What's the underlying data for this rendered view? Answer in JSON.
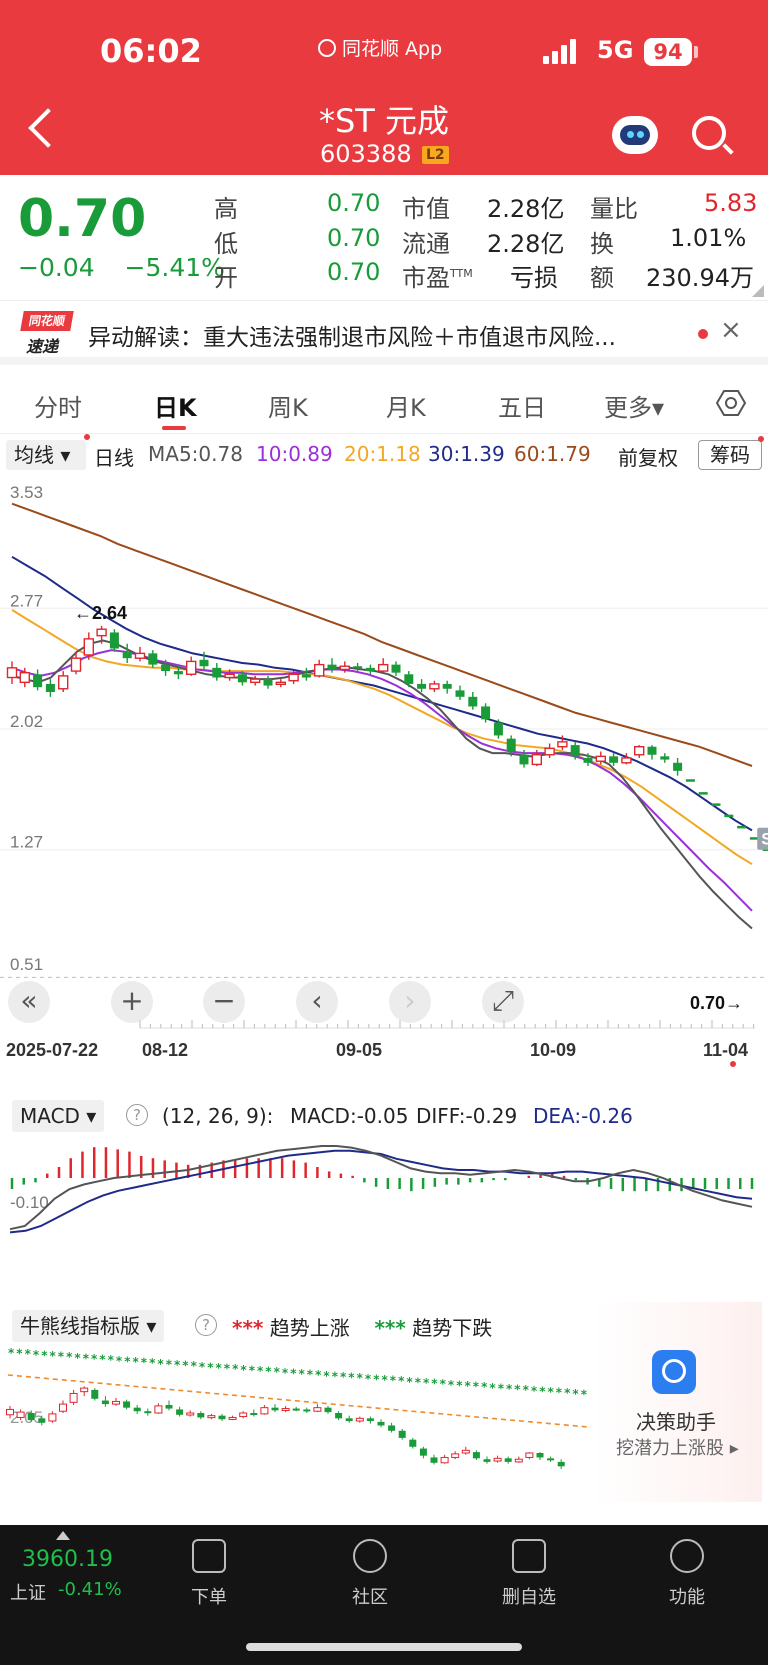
{
  "status_bar": {
    "time": "06:02",
    "app": "同花顺 App",
    "network": "5G",
    "battery": "94"
  },
  "header": {
    "stock_name": "*ST 元成",
    "stock_code": "603388",
    "level_badge": "L2"
  },
  "quote": {
    "price": "0.70",
    "change": "−0.04",
    "change_pct": "−5.41%",
    "high_label": "高",
    "high": "0.70",
    "low_label": "低",
    "low": "0.70",
    "open_label": "开",
    "open": "0.70",
    "mcap_label": "市值",
    "mcap": "2.28亿",
    "float_label": "流通",
    "float": "2.28亿",
    "pe_label": "市盈",
    "pe_sup": "TTM",
    "pe": "亏损",
    "volratio_label": "量比",
    "volratio": "5.83",
    "turnover_label": "换",
    "turnover": "1.01%",
    "amount_label": "额",
    "amount": "230.94万"
  },
  "news": {
    "logo_top": "同花顺",
    "logo_bottom": "速递",
    "text": "异动解读：重大违法强制退市风险＋市值退市风险...",
    "close": "×"
  },
  "tabs": [
    "分时",
    "日K",
    "周K",
    "月K",
    "五日",
    "更多▾"
  ],
  "active_tab": 1,
  "ma_bar": {
    "selector": "均线 ▾",
    "period": "日线",
    "ma5": "MA5:0.78",
    "ma10": "10:0.89",
    "ma20": "20:1.18",
    "ma30": "30:1.39",
    "ma60": "60:1.79",
    "adjust": "前复权",
    "chips": "筹码"
  },
  "colors": {
    "up": "#e0262d",
    "down": "#1a9b3a",
    "ma5": "#555555",
    "ma10": "#9b2fd8",
    "ma20": "#f3a825",
    "ma30": "#1f2a8a",
    "ma60": "#9b4a1a"
  },
  "kline": {
    "y_ticks": [
      "3.53",
      "2.77",
      "2.02",
      "1.27",
      "0.51"
    ],
    "high_marker": "←2.64",
    "last_marker": "0.70→",
    "signal_marker": "S",
    "x_ticks": [
      "2025-07-22",
      "08-12",
      "09-05",
      "10-09",
      "11-04"
    ],
    "controls": [
      "«",
      "+",
      "−",
      "‹",
      "›",
      "⤢"
    ]
  },
  "macd": {
    "selector": "MACD ▾",
    "params": "(12, 26, 9):",
    "macd": "MACD:-0.05",
    "diff": "DIFF:-0.29",
    "dea": "DEA:-0.26",
    "y_tick": "-0.10"
  },
  "bull_bear": {
    "selector": "牛熊线指标版 ▾",
    "legend_up_marks": "***",
    "legend_up": "趋势上涨",
    "legend_down_marks": "***",
    "legend_down": "趋势下跌",
    "y_tick": "2.05"
  },
  "assistant": {
    "title": "决策助手",
    "subtitle": "挖潜力上涨股 ▸"
  },
  "index": {
    "value": "3960.19",
    "name": "上证",
    "pct": "-0.41%"
  },
  "bottom_nav": [
    "下单",
    "社区",
    "删自选",
    "功能"
  ],
  "candles": [
    [
      2.34,
      2.4,
      2.44,
      2.3
    ],
    [
      2.31,
      2.37,
      2.4,
      2.28
    ],
    [
      2.36,
      2.28,
      2.39,
      2.26
    ],
    [
      2.3,
      2.25,
      2.33,
      2.22
    ],
    [
      2.27,
      2.35,
      2.38,
      2.25
    ],
    [
      2.38,
      2.46,
      2.5,
      2.36
    ],
    [
      2.48,
      2.58,
      2.62,
      2.45
    ],
    [
      2.6,
      2.64,
      2.66,
      2.55
    ],
    [
      2.62,
      2.52,
      2.64,
      2.5
    ],
    [
      2.5,
      2.46,
      2.55,
      2.43
    ],
    [
      2.46,
      2.49,
      2.53,
      2.44
    ],
    [
      2.49,
      2.42,
      2.51,
      2.4
    ],
    [
      2.42,
      2.38,
      2.45,
      2.35
    ],
    [
      2.38,
      2.36,
      2.41,
      2.33
    ],
    [
      2.36,
      2.44,
      2.47,
      2.35
    ],
    [
      2.45,
      2.41,
      2.5,
      2.39
    ],
    [
      2.4,
      2.34,
      2.43,
      2.32
    ],
    [
      2.34,
      2.36,
      2.39,
      2.32
    ],
    [
      2.36,
      2.31,
      2.38,
      2.29
    ],
    [
      2.31,
      2.33,
      2.35,
      2.29
    ],
    [
      2.33,
      2.29,
      2.35,
      2.27
    ],
    [
      2.3,
      2.31,
      2.33,
      2.28
    ],
    [
      2.32,
      2.36,
      2.38,
      2.3
    ],
    [
      2.36,
      2.34,
      2.4,
      2.32
    ],
    [
      2.35,
      2.42,
      2.45,
      2.34
    ],
    [
      2.42,
      2.39,
      2.46,
      2.37
    ],
    [
      2.39,
      2.41,
      2.44,
      2.37
    ],
    [
      2.41,
      2.4,
      2.43,
      2.38
    ],
    [
      2.4,
      2.38,
      2.42,
      2.36
    ],
    [
      2.38,
      2.42,
      2.46,
      2.37
    ],
    [
      2.42,
      2.37,
      2.44,
      2.35
    ],
    [
      2.36,
      2.3,
      2.38,
      2.28
    ],
    [
      2.3,
      2.27,
      2.33,
      2.25
    ],
    [
      2.27,
      2.3,
      2.32,
      2.25
    ],
    [
      2.3,
      2.27,
      2.32,
      2.24
    ],
    [
      2.26,
      2.22,
      2.29,
      2.2
    ],
    [
      2.22,
      2.16,
      2.25,
      2.14
    ],
    [
      2.16,
      2.08,
      2.18,
      2.06
    ],
    [
      2.06,
      1.98,
      2.08,
      1.96
    ],
    [
      1.96,
      1.88,
      1.98,
      1.85
    ],
    [
      1.86,
      1.8,
      1.89,
      1.78
    ],
    [
      1.8,
      1.86,
      1.89,
      1.79
    ],
    [
      1.86,
      1.9,
      1.93,
      1.84
    ],
    [
      1.91,
      1.94,
      1.98,
      1.89
    ],
    [
      1.92,
      1.85,
      1.94,
      1.83
    ],
    [
      1.84,
      1.81,
      1.87,
      1.79
    ],
    [
      1.82,
      1.85,
      1.88,
      1.8
    ],
    [
      1.85,
      1.81,
      1.87,
      1.79
    ],
    [
      1.81,
      1.84,
      1.87,
      1.8
    ],
    [
      1.86,
      1.91,
      1.92,
      1.84
    ],
    [
      1.91,
      1.86,
      1.92,
      1.83
    ],
    [
      1.85,
      1.83,
      1.87,
      1.81
    ],
    [
      1.81,
      1.76,
      1.84,
      1.73
    ]
  ],
  "limit_down_steps": [
    1.7,
    1.62,
    1.55,
    1.48,
    1.41,
    1.34,
    1.27,
    1.21,
    1.15,
    1.09,
    1.04,
    0.99,
    0.94,
    0.9,
    0.86,
    0.82,
    0.78,
    0.74,
    0.7
  ],
  "ma_lines": {
    "ma5": [
      2.35,
      2.33,
      2.31,
      2.34,
      2.42,
      2.5,
      2.55,
      2.57,
      2.55,
      2.51,
      2.47,
      2.44,
      2.42,
      2.4,
      2.38,
      2.36,
      2.35,
      2.34,
      2.34,
      2.33,
      2.33,
      2.34,
      2.36,
      2.38,
      2.39,
      2.4,
      2.4,
      2.39,
      2.38,
      2.36,
      2.32,
      2.27,
      2.21,
      2.14,
      2.05,
      1.96,
      1.9,
      1.87,
      1.87,
      1.86,
      1.85,
      1.86,
      1.87,
      1.87,
      1.86,
      1.84,
      1.8,
      1.72,
      1.62,
      1.51,
      1.4,
      1.3,
      1.2,
      1.1,
      1.01,
      0.93,
      0.85,
      0.78
    ],
    "ma10": [
      2.4,
      2.37,
      2.35,
      2.37,
      2.41,
      2.46,
      2.49,
      2.51,
      2.5,
      2.48,
      2.45,
      2.43,
      2.41,
      2.39,
      2.38,
      2.37,
      2.37,
      2.36,
      2.36,
      2.36,
      2.37,
      2.38,
      2.39,
      2.39,
      2.38,
      2.36,
      2.33,
      2.29,
      2.24,
      2.18,
      2.11,
      2.04,
      1.98,
      1.93,
      1.9,
      1.88,
      1.87,
      1.87,
      1.87,
      1.86,
      1.84,
      1.8,
      1.75,
      1.68,
      1.6,
      1.51,
      1.42,
      1.33,
      1.24,
      1.15,
      1.07,
      0.98,
      0.89
    ],
    "ma20": [
      2.76,
      2.7,
      2.64,
      2.58,
      2.52,
      2.47,
      2.44,
      2.42,
      2.41,
      2.4,
      2.4,
      2.39,
      2.39,
      2.38,
      2.38,
      2.38,
      2.38,
      2.38,
      2.37,
      2.36,
      2.35,
      2.33,
      2.3,
      2.27,
      2.23,
      2.18,
      2.13,
      2.08,
      2.03,
      1.99,
      1.96,
      1.94,
      1.92,
      1.91,
      1.9,
      1.88,
      1.85,
      1.81,
      1.77,
      1.72,
      1.66,
      1.59,
      1.52,
      1.45,
      1.38,
      1.31,
      1.24,
      1.18
    ],
    "ma30": [
      3.09,
      3.03,
      2.97,
      2.9,
      2.83,
      2.76,
      2.7,
      2.64,
      2.59,
      2.55,
      2.52,
      2.49,
      2.47,
      2.45,
      2.43,
      2.42,
      2.4,
      2.39,
      2.37,
      2.35,
      2.33,
      2.31,
      2.29,
      2.26,
      2.23,
      2.2,
      2.17,
      2.14,
      2.11,
      2.08,
      2.05,
      2.02,
      1.99,
      1.97,
      1.95,
      1.93,
      1.9,
      1.86,
      1.82,
      1.77,
      1.72,
      1.66,
      1.59,
      1.52,
      1.45,
      1.39
    ],
    "ma60": [
      3.42,
      3.38,
      3.34,
      3.3,
      3.26,
      3.22,
      3.17,
      3.13,
      3.09,
      3.05,
      3.01,
      2.97,
      2.93,
      2.89,
      2.85,
      2.81,
      2.77,
      2.73,
      2.69,
      2.65,
      2.61,
      2.56,
      2.52,
      2.48,
      2.44,
      2.4,
      2.36,
      2.32,
      2.28,
      2.24,
      2.2,
      2.16,
      2.12,
      2.09,
      2.06,
      2.03,
      2.0,
      1.97,
      1.94,
      1.91,
      1.87,
      1.83,
      1.79
    ]
  },
  "macd_hist": [
    -0.05,
    -0.03,
    -0.02,
    0.02,
    0.05,
    0.09,
    0.12,
    0.14,
    0.14,
    0.13,
    0.12,
    0.1,
    0.09,
    0.08,
    0.07,
    0.06,
    0.06,
    0.07,
    0.08,
    0.08,
    0.09,
    0.09,
    0.09,
    0.09,
    0.08,
    0.07,
    0.05,
    0.03,
    0.02,
    0.01,
    -0.02,
    -0.04,
    -0.05,
    -0.05,
    -0.06,
    -0.05,
    -0.04,
    -0.03,
    -0.03,
    -0.02,
    -0.02,
    -0.01,
    -0.01,
    0.0,
    0.01,
    0.02,
    0.02,
    0.01,
    -0.01,
    -0.03,
    -0.04,
    -0.05,
    -0.06,
    -0.06,
    -0.06,
    -0.06,
    -0.06,
    -0.06,
    -0.05,
    -0.05,
    -0.05,
    -0.05,
    -0.05,
    -0.05
  ]
}
